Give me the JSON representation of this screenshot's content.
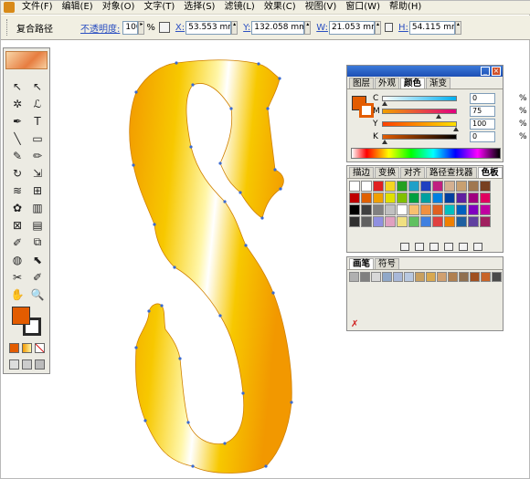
{
  "menu": {
    "items": [
      "文件(F)",
      "编辑(E)",
      "对象(O)",
      "文字(T)",
      "选择(S)",
      "滤镜(L)",
      "效果(C)",
      "视图(V)",
      "窗口(W)",
      "帮助(H)"
    ]
  },
  "control_bar": {
    "selection_label": "复合路径",
    "opacity_label": "不透明度:",
    "opacity_value": "100",
    "opacity_unit": "%",
    "x_label": "X:",
    "x_value": "53.553 mm",
    "y_label": "Y:",
    "y_value": "132.058 mm",
    "w_label": "W:",
    "w_value": "21.053 mm",
    "h_label": "H:",
    "h_value": "54.115 mm"
  },
  "toolbox": {
    "tool_icons": [
      "selection-icon",
      "direct-selection-icon",
      "magic-wand-icon",
      "lasso-icon",
      "pen-icon",
      "type-icon",
      "line-icon",
      "rectangle-icon",
      "paintbrush-icon",
      "pencil-icon",
      "rotate-icon",
      "scale-icon",
      "warp-icon",
      "free-transform-icon",
      "symbol-sprayer-icon",
      "graph-icon",
      "mesh-icon",
      "gradient-icon",
      "eyedropper-icon",
      "blend-icon",
      "live-paint-icon",
      "live-paint-select-icon",
      "slice-icon",
      "eraser-icon",
      "hand-icon",
      "zoom-icon"
    ],
    "tool_glyphs": [
      "↖",
      "↖",
      "✲",
      "ℒ",
      "✒",
      "T",
      "╲",
      "▭",
      "✎",
      "✏",
      "↻",
      "⇲",
      "≋",
      "⊞",
      "✿",
      "▥",
      "⊠",
      "▤",
      "✐",
      "⧉",
      "◍",
      "⬉",
      "✂",
      "✐",
      "✋",
      "🔍"
    ],
    "fill_color": "#e35c00",
    "stroke_color": "#ffffff"
  },
  "color_panel": {
    "tabs": [
      "图层",
      "外观",
      "颜色",
      "渐变"
    ],
    "active_tab": 2,
    "sliders": [
      {
        "label": "C",
        "value": "0",
        "level": 0.0
      },
      {
        "label": "M",
        "value": "75",
        "level": 0.75
      },
      {
        "label": "Y",
        "value": "100",
        "level": 1.0
      },
      {
        "label": "K",
        "value": "0",
        "level": 0.0
      }
    ],
    "percent": "%",
    "fill_color": "#e35c00",
    "stroke_color": "#e35c00"
  },
  "swatches_panel": {
    "tabs": [
      "描边",
      "变换",
      "对齐",
      "路径查找器",
      "色板"
    ],
    "active_tab": 4,
    "rows": [
      [
        "#ffffff",
        "#ffffff",
        "#e02020",
        "#f4d520",
        "#24a020",
        "#20a0c8",
        "#2040c0",
        "#c02080",
        "#d4b090",
        "#c8a070",
        "#a07850",
        "#784020"
      ],
      [
        "#c00000",
        "#e06000",
        "#f0a000",
        "#e0e000",
        "#80c000",
        "#00a040",
        "#00a0a0",
        "#0080e0",
        "#0040a0",
        "#6020a0",
        "#a00080",
        "#e00060"
      ],
      [
        "#000000",
        "#404040",
        "#808080",
        "#c0c0c0",
        "#ffffff",
        "#f8c070",
        "#f09040",
        "#e06020",
        "#00c0c0",
        "#0060c0",
        "#8000c0",
        "#c000a0"
      ],
      [
        "#303030",
        "#606060",
        "#9090e0",
        "#e0a0c0",
        "#f0e080",
        "#60c060",
        "#4080e0",
        "#e04040",
        "#f08000",
        "#2060a0",
        "#6040a0",
        "#a02060"
      ]
    ]
  },
  "brush_panel": {
    "tabs": [
      "画笔",
      "符号"
    ],
    "active_tab": 0,
    "row": [
      "#b0b0b0",
      "#808080",
      "#d8d8d8",
      "#90a8c8",
      "#a8b8d8",
      "#b8c8e0",
      "#c8a060",
      "#d8a850",
      "#d0a070",
      "#b08050",
      "#907050",
      "#a05020",
      "#c86428",
      "#4a4a4a"
    ]
  },
  "artwork": {
    "gradient_dark": "#f29800",
    "gradient_mid": "#f7c800",
    "gradient_light": "#fff6a8",
    "gradient_core": "#ffffff"
  }
}
